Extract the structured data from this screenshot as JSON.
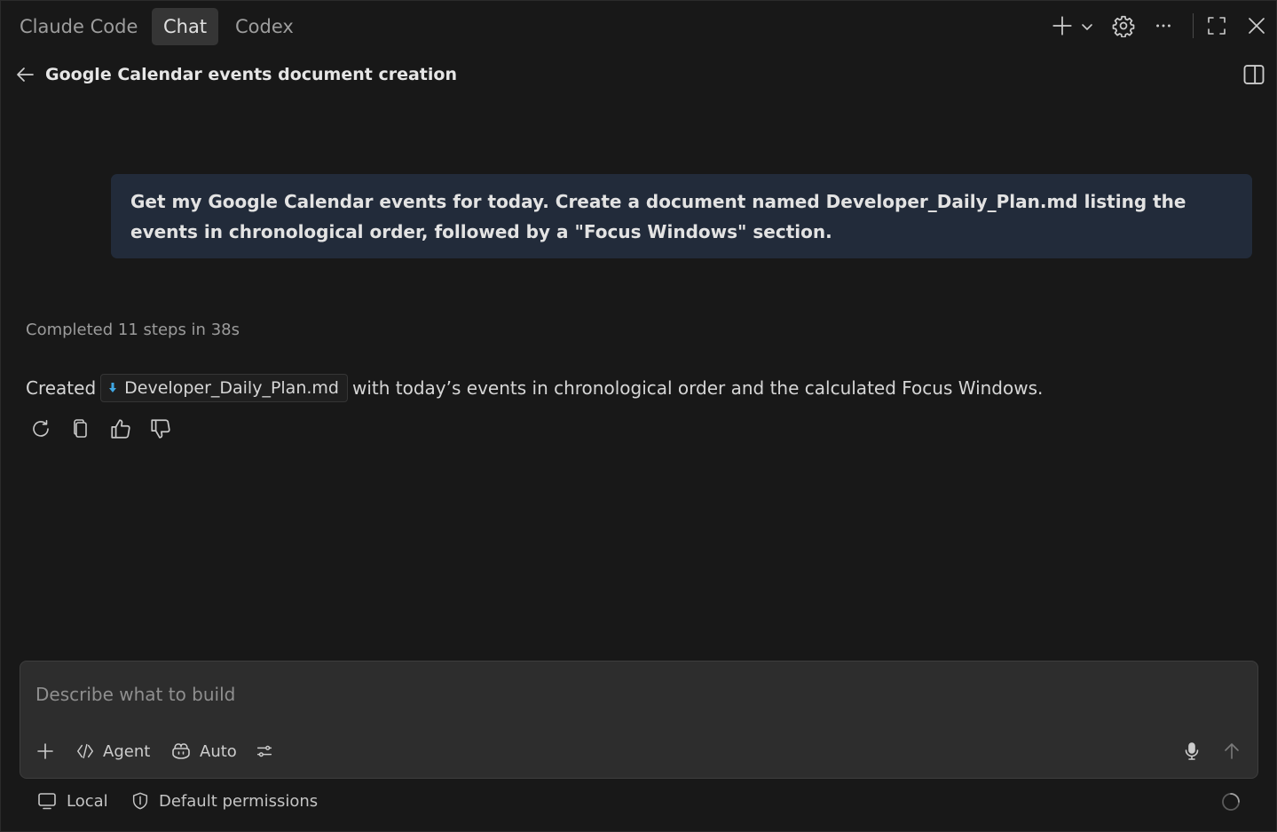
{
  "tabs": [
    {
      "label": "Claude Code",
      "active": false
    },
    {
      "label": "Chat",
      "active": true
    },
    {
      "label": "Codex",
      "active": false
    }
  ],
  "toolbar_icons": [
    "plus-icon",
    "chevron-down-icon",
    "gear-icon",
    "more-icon",
    "maximize-icon",
    "close-icon"
  ],
  "header": {
    "title": "Google Calendar events document creation"
  },
  "conversation": {
    "user_message": "Get my Google Calendar events for today. Create a document named Developer_Daily_Plan.md listing the events in chronological order, followed by a \"Focus Windows\" section.",
    "status": "Completed 11 steps in 38s",
    "answer": {
      "prefix": "Created",
      "file_chip": "Developer_Daily_Plan.md",
      "suffix": "with today’s events in chronological order and the calculated Focus Windows."
    },
    "actions": [
      "retry-icon",
      "copy-icon",
      "thumbs-up-icon",
      "thumbs-down-icon"
    ]
  },
  "composer": {
    "placeholder": "Describe what to build",
    "value": "",
    "mode_label": "Agent",
    "model_label": "Auto"
  },
  "footer": {
    "location_label": "Local",
    "permissions_label": "Default permissions"
  },
  "colors": {
    "background": "#181818",
    "user_bubble": "#222b3a",
    "composer": "#2d2d2d",
    "md_icon": "#3fa7e3"
  }
}
